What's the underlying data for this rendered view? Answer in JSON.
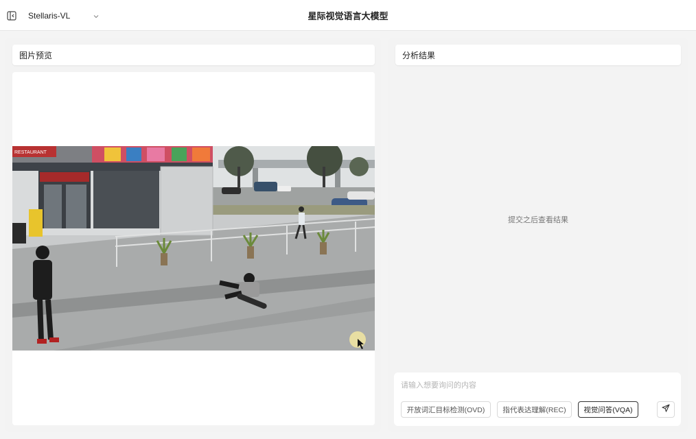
{
  "header": {
    "title": "星际视觉语言大模型",
    "model_select": {
      "value": "Stellaris-VL"
    },
    "icons": {
      "sidebar_toggle": "sidebar-toggle-icon",
      "dropdown": "chevron-down-icon"
    }
  },
  "preview_panel": {
    "title": "图片预览"
  },
  "result_panel": {
    "title": "分析结果",
    "placeholder": "提交之后查看结果"
  },
  "input": {
    "placeholder": "请输入想要询问的内容",
    "value": ""
  },
  "modes": [
    {
      "label": "开放词汇目标检测(OVD)",
      "active": false
    },
    {
      "label": "指代表达理解(REC)",
      "active": false
    },
    {
      "label": "视觉问答(VQA)",
      "active": true
    }
  ],
  "send_icon": "send-icon",
  "photo": {
    "sign_text": "RESTAURANT"
  },
  "colors": {
    "background": "#f4f4f4",
    "panel": "#f3f3f3",
    "card": "#ffffff",
    "active_border": "#333333"
  }
}
